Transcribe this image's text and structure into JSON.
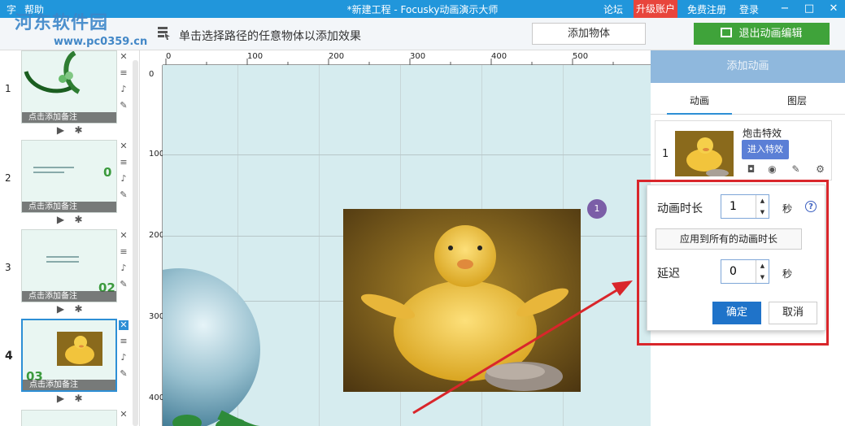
{
  "titlebar": {
    "menu_file": "字",
    "menu_help": "帮助",
    "title": "*新建工程 - Focusky动画演示大师",
    "forum": "论坛",
    "upgrade": "升级账户",
    "register": "免费注册",
    "login": "登录",
    "minimize": "−",
    "maximize": "□",
    "close": "✕"
  },
  "watermark": {
    "name": "河东软件园",
    "url": "www.pc0359.cn"
  },
  "toolbar": {
    "hint": "单击选择路径的任意物体以添加效果",
    "add_object": "添加物体",
    "exit_anim": "退出动画编辑"
  },
  "slides": {
    "items": [
      {
        "number": "1",
        "note": "点击添加备注",
        "badge": ""
      },
      {
        "number": "2",
        "note": "点击添加备注",
        "badge": "0"
      },
      {
        "number": "3",
        "note": "点击添加备注",
        "badge": "02"
      },
      {
        "number": "4",
        "note": "点击添加备注",
        "badge": "03"
      }
    ]
  },
  "ruler": {
    "top": [
      "0",
      "100",
      "200",
      "300",
      "400",
      "500"
    ],
    "left": [
      "0",
      "100",
      "200",
      "300",
      "400"
    ]
  },
  "canvas": {
    "step_badge": "1"
  },
  "right_panel": {
    "add_animation": "添加动画",
    "tab_animation": "动画",
    "tab_layers": "图层",
    "anim_item": {
      "index": "1",
      "name": "炮击特效",
      "enter_btn": "进入特效"
    }
  },
  "popup": {
    "duration_label": "动画时长",
    "duration_value": "1",
    "duration_unit": "秒",
    "apply_all": "应用到所有的动画时长",
    "delay_label": "延迟",
    "delay_value": "0",
    "delay_unit": "秒",
    "ok": "确定",
    "cancel": "取消",
    "help": "?"
  },
  "colors": {
    "titlebar": "#2196db",
    "exit_btn": "#3fa33a",
    "accent": "#1f73c9",
    "highlight_frame": "#d9262b"
  }
}
